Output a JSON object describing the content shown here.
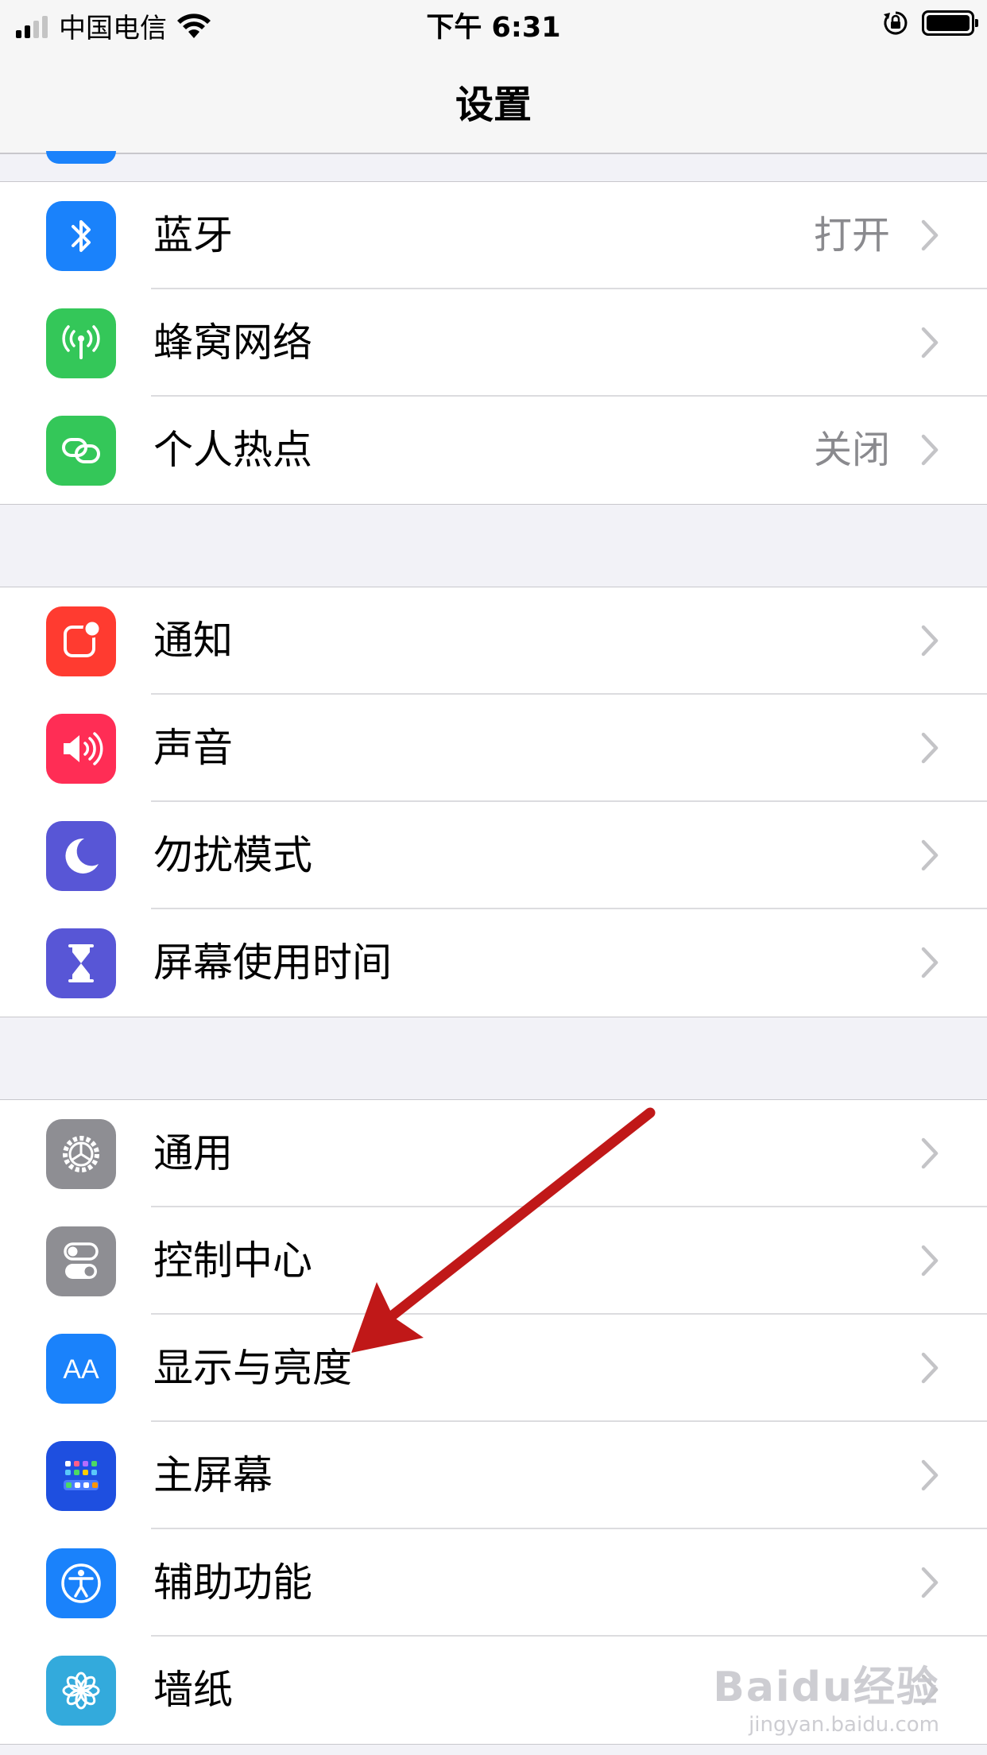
{
  "status_bar": {
    "carrier": "中国电信",
    "time": "下午 6:31"
  },
  "nav": {
    "title": "设置"
  },
  "groups": [
    [
      {
        "label": "蓝牙",
        "value": "打开",
        "icon": "bluetooth-icon",
        "color": "#1a82fb"
      },
      {
        "label": "蜂窝网络",
        "value": "",
        "icon": "cellular-antenna-icon",
        "color": "#34c759"
      },
      {
        "label": "个人热点",
        "value": "关闭",
        "icon": "personal-hotspot-icon",
        "color": "#34c759"
      }
    ],
    [
      {
        "label": "通知",
        "value": "",
        "icon": "notifications-icon",
        "color": "#ff3b30"
      },
      {
        "label": "声音",
        "value": "",
        "icon": "speaker-icon",
        "color": "#ff2d55"
      },
      {
        "label": "勿扰模式",
        "value": "",
        "icon": "moon-icon",
        "color": "#5856d6"
      },
      {
        "label": "屏幕使用时间",
        "value": "",
        "icon": "hourglass-icon",
        "color": "#5856d6"
      }
    ],
    [
      {
        "label": "通用",
        "value": "",
        "icon": "gear-icon",
        "color": "#8e8e93"
      },
      {
        "label": "控制中心",
        "value": "",
        "icon": "toggles-icon",
        "color": "#8e8e93"
      },
      {
        "label": "显示与亮度",
        "value": "",
        "icon": "text-size-icon",
        "color": "#1a82fb"
      },
      {
        "label": "主屏幕",
        "value": "",
        "icon": "home-screen-icon",
        "color": "#1e4fe0"
      },
      {
        "label": "辅助功能",
        "value": "",
        "icon": "accessibility-icon",
        "color": "#1a82fb"
      },
      {
        "label": "墙纸",
        "value": "",
        "icon": "flower-icon",
        "color": "#33aadc"
      }
    ]
  ],
  "icon_text": {
    "text_size": "AA"
  },
  "watermark": {
    "main": "Baidu经验",
    "sub": "jingyan.baidu.com"
  },
  "annotation": {
    "arrow_color": "#c01818"
  }
}
